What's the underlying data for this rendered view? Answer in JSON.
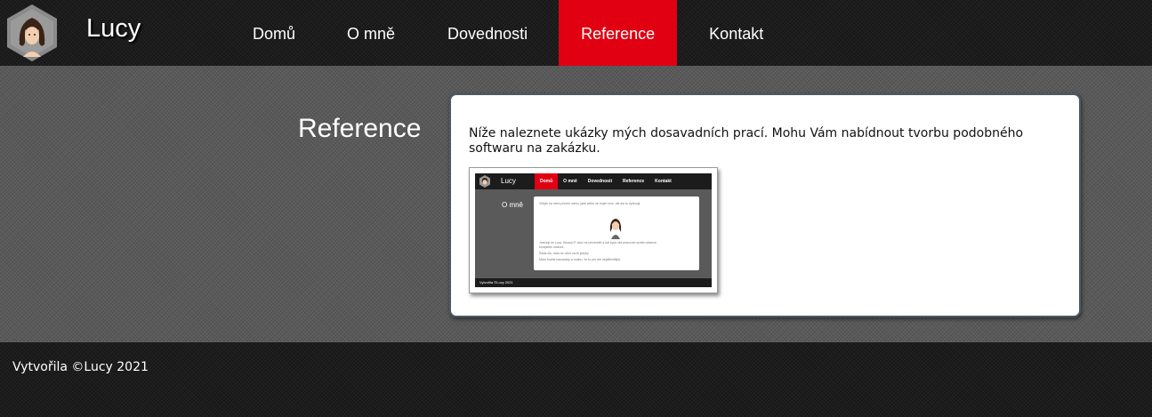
{
  "header": {
    "brand": "Lucy",
    "logo_icon": "avatar-hexagon-icon",
    "nav": [
      {
        "label": "Domů",
        "active": false
      },
      {
        "label": "O mně",
        "active": false
      },
      {
        "label": "Dovednosti",
        "active": false
      },
      {
        "label": "Reference",
        "active": true
      },
      {
        "label": "Kontakt",
        "active": false
      }
    ]
  },
  "main": {
    "title": "Reference",
    "intro": "Níže naleznete ukázky mých dosavadních prací. Mohu Vám nabídnout tvorbu podobného softwaru na zakázku.",
    "thumbnail": {
      "brand": "Lucy",
      "nav": [
        "Domů",
        "O mně",
        "Dovednosti",
        "Reference",
        "Kontakt"
      ],
      "title": "O mně",
      "lines": [
        "Vítejte na mém prvním webu, jaké webu se bojím více, ale asi to vyzkouji.",
        "Jmenuji se Lucy. Studuji IT obor na univerzitě a dal bych rád pracovat na této stránce.",
        "kompletní stránce.",
        "Ráda čtu, ráda se učím nové jazyky.",
        "Mám hodné kamarády a rodinu. Je to pro mě nejdůležitější."
      ],
      "footer": "Vytvořila ©Lucy 2021"
    }
  },
  "footer": {
    "text": "Vytvořila ©Lucy 2021"
  },
  "colors": {
    "accent": "#e00012",
    "header_bg": "#1c1c1c",
    "main_bg": "#5a5a5a",
    "card_border": "#4a5a66"
  }
}
